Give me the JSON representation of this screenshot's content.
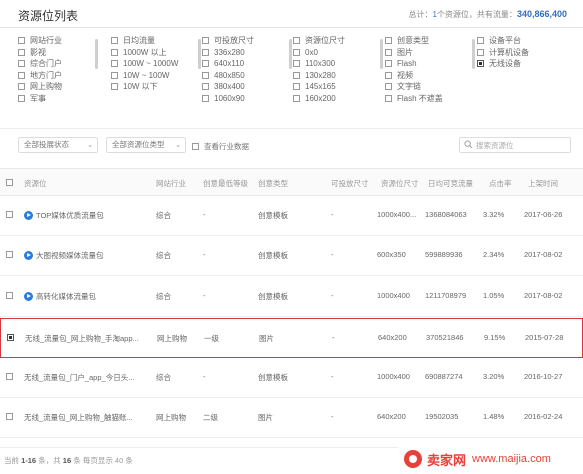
{
  "header": {
    "title": "资源位列表",
    "summary_prefix": "总计：",
    "summary_count": "1",
    "summary_mid": "个资源位，共有流量：",
    "summary_total": "340,866,400"
  },
  "filters": {
    "col1": [
      {
        "label": "网站行业",
        "checked": false
      },
      {
        "label": "影视",
        "checked": false
      },
      {
        "label": "综合门户",
        "checked": false
      },
      {
        "label": "地方门户",
        "checked": false
      },
      {
        "label": "网上购物",
        "checked": false
      },
      {
        "label": "军事",
        "checked": false
      }
    ],
    "col2": [
      {
        "label": "日均流量",
        "checked": false
      },
      {
        "label": "1000W 以上",
        "checked": false
      },
      {
        "label": "100W ~ 1000W",
        "checked": false
      },
      {
        "label": "10W ~ 100W",
        "checked": false
      },
      {
        "label": "10W 以下",
        "checked": false
      }
    ],
    "col3": [
      {
        "label": "可投放尺寸",
        "checked": false
      },
      {
        "label": "336x280",
        "checked": false
      },
      {
        "label": "640x110",
        "checked": false
      },
      {
        "label": "480x850",
        "checked": false
      },
      {
        "label": "380x400",
        "checked": false
      },
      {
        "label": "1060x90",
        "checked": false
      }
    ],
    "col4": [
      {
        "label": "资源位尺寸",
        "checked": false
      },
      {
        "label": "0x0",
        "checked": false
      },
      {
        "label": "110x300",
        "checked": false
      },
      {
        "label": "130x280",
        "checked": false
      },
      {
        "label": "145x165",
        "checked": false
      },
      {
        "label": "160x200",
        "checked": false
      }
    ],
    "col5": [
      {
        "label": "创意类型",
        "checked": false
      },
      {
        "label": "图片",
        "checked": false
      },
      {
        "label": "Flash",
        "checked": false
      },
      {
        "label": "视频",
        "checked": false
      },
      {
        "label": "文字链",
        "checked": false
      },
      {
        "label": "Flash 不遮盖",
        "checked": false
      }
    ],
    "col6": [
      {
        "label": "设备平台",
        "checked": false
      },
      {
        "label": "计算机设备",
        "checked": false
      },
      {
        "label": "无线设备",
        "checked": true
      }
    ]
  },
  "toolbar": {
    "select1": "全部投展状态",
    "select2": "全部资源位类型",
    "industry_checkbox": "查看行业数据",
    "search_placeholder": "搜索资源位"
  },
  "table": {
    "columns": [
      "资源位",
      "网站行业",
      "创意最低等级",
      "创意类型",
      "可投放尺寸",
      "资源位尺寸",
      "日均可竞流量",
      "点击率",
      "上架时间"
    ],
    "rows": [
      {
        "name": "TOP媒体优质流量包",
        "icon": true,
        "industry": "综合",
        "level": "-",
        "type": "创意模板",
        "allowed": "-",
        "size": "1000x400...",
        "traffic": "1368084063",
        "ctr": "3.32%",
        "date": "2017-06-26",
        "checked": false
      },
      {
        "name": "大图视频媒体流量包",
        "icon": true,
        "industry": "综合",
        "level": "-",
        "type": "创意模板",
        "allowed": "-",
        "size": "600x350",
        "traffic": "599889936",
        "ctr": "2.34%",
        "date": "2017-08-02",
        "checked": false
      },
      {
        "name": "高转化媒体流量包",
        "icon": true,
        "industry": "综合",
        "level": "-",
        "type": "创意模板",
        "allowed": "-",
        "size": "1000x400",
        "traffic": "1211708979",
        "ctr": "1.05%",
        "date": "2017-08-02",
        "checked": false
      },
      {
        "name": "无线_流量包_网上购物_手淘app...",
        "icon": false,
        "industry": "网上购物",
        "level": "一级",
        "type": "图片",
        "allowed": "-",
        "size": "640x200",
        "traffic": "370521846",
        "ctr": "9.15%",
        "date": "2015-07-28",
        "checked": true
      },
      {
        "name": "无线_流量包_门户_app_今日头...",
        "icon": false,
        "industry": "综合",
        "level": "-",
        "type": "创意模板",
        "allowed": "-",
        "size": "1000x400",
        "traffic": "690887274",
        "ctr": "3.20%",
        "date": "2016-10-27",
        "checked": false
      },
      {
        "name": "无线_流量包_网上购物_触猫账...",
        "icon": false,
        "industry": "网上购物",
        "level": "二级",
        "type": "图片",
        "allowed": "-",
        "size": "640x200",
        "traffic": "19502035",
        "ctr": "1.48%",
        "date": "2016-02-24",
        "checked": false
      }
    ]
  },
  "footer": {
    "prefix": "当前",
    "range": "1-16",
    "mid": "条，共",
    "total": "16",
    "suffix": "条 每页显示",
    "per_page": "40",
    "end": "条"
  },
  "watermark": {
    "cn": "卖家网",
    "url": "www.maijia.com"
  }
}
